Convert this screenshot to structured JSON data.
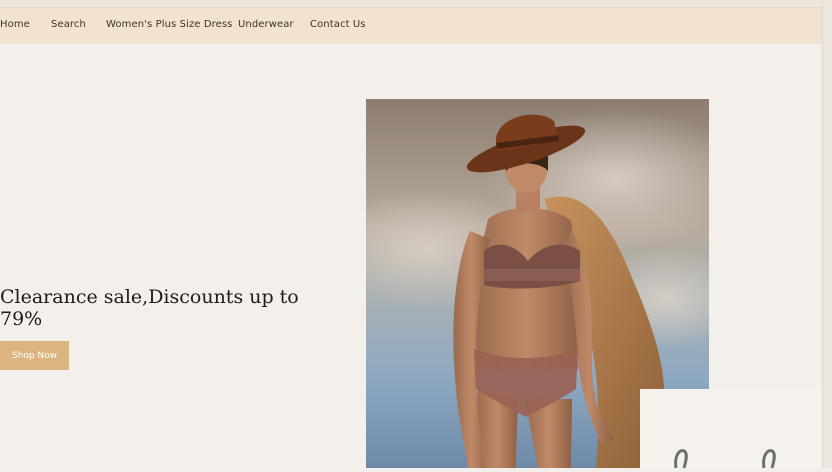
{
  "nav": {
    "items": [
      {
        "label": "Home"
      },
      {
        "label": "Search"
      },
      {
        "label": "Women's Plus Size Dress"
      },
      {
        "label": "Underwear"
      },
      {
        "label": "Contact Us"
      }
    ]
  },
  "hero": {
    "headline": "Clearance sale,Discounts up to 79%",
    "cta_label": "Shop Now",
    "image_alt": "Model in lace lingerie wearing a wide-brim hat and shearling coat against a cloudy sky"
  },
  "colors": {
    "accent": "#dcb480",
    "nav_bg": "#f2e3d0",
    "page_bg": "#f3efea"
  }
}
